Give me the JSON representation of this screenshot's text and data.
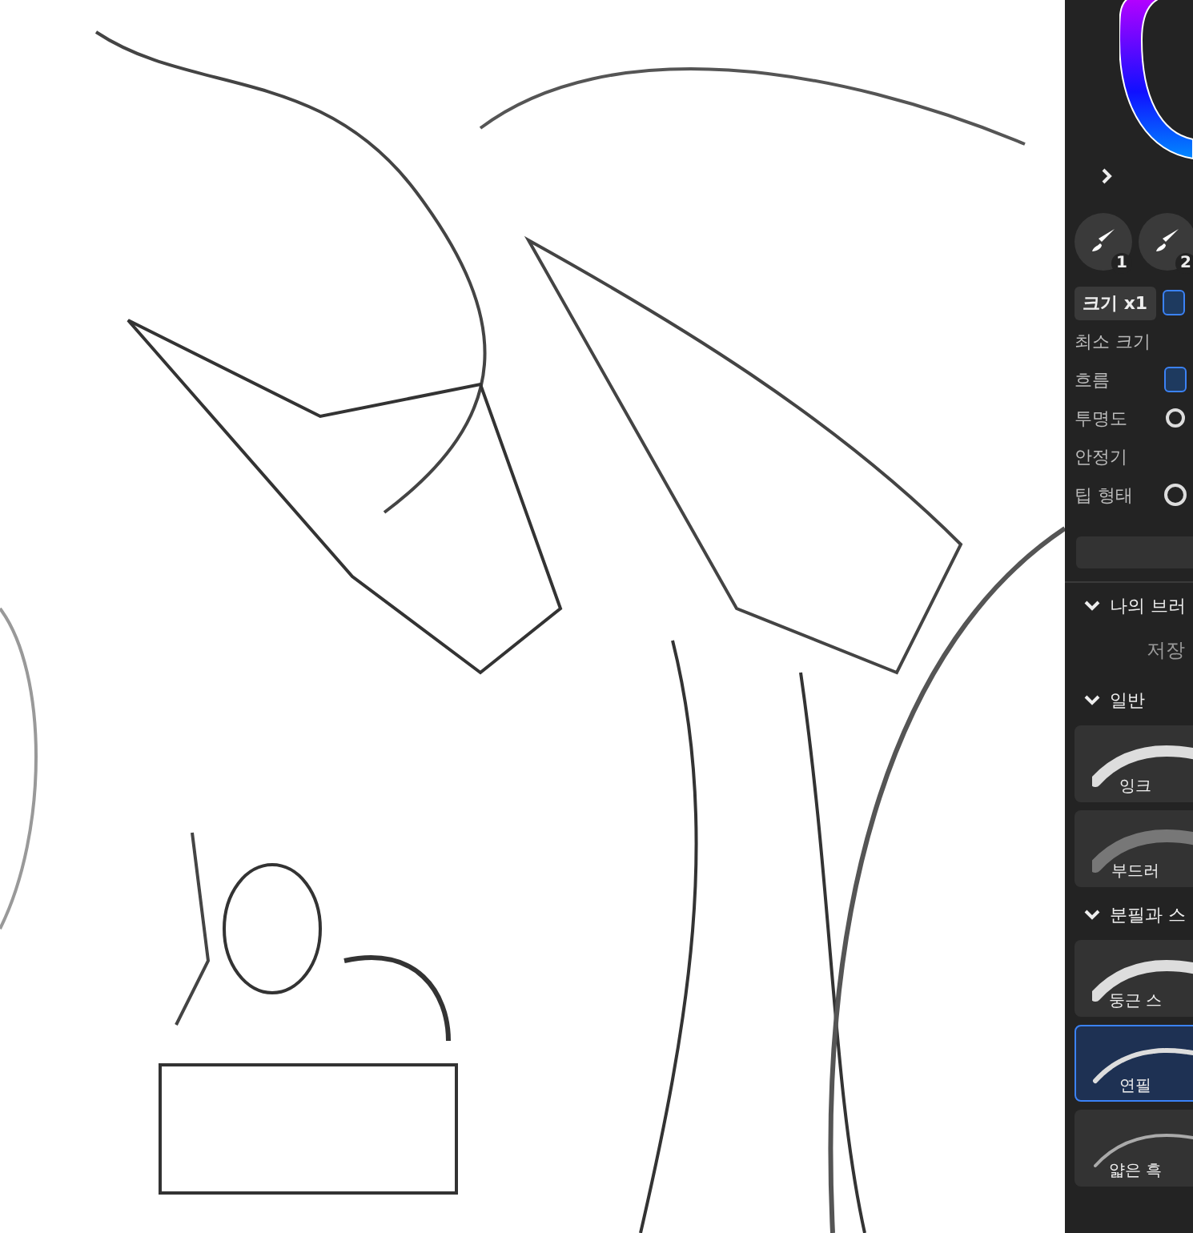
{
  "panel": {
    "slots": [
      "1",
      "2"
    ],
    "size_badge": "크기 x1",
    "settings": [
      {
        "label": "최소 크기",
        "kind": "none"
      },
      {
        "label": "흐름",
        "kind": "active"
      },
      {
        "label": "투명도",
        "kind": "plain"
      },
      {
        "label": "안정기",
        "kind": "none"
      },
      {
        "label": "팁 형태",
        "kind": "ring"
      }
    ],
    "sections": [
      {
        "title": "나의 브러",
        "expanded": true,
        "empty_text": "저장"
      },
      {
        "title": "일반",
        "expanded": true,
        "items": [
          {
            "label": "잉크",
            "selected": false,
            "kind": "ink"
          },
          {
            "label": "부드러",
            "selected": false,
            "kind": "soft"
          }
        ]
      },
      {
        "title": "분필과 스",
        "expanded": true,
        "items": [
          {
            "label": "둥근 스",
            "selected": false,
            "kind": "ink"
          },
          {
            "label": "연필",
            "selected": true,
            "kind": "pencil"
          },
          {
            "label": "얇은 흑",
            "selected": false,
            "kind": "thin"
          }
        ]
      }
    ]
  }
}
